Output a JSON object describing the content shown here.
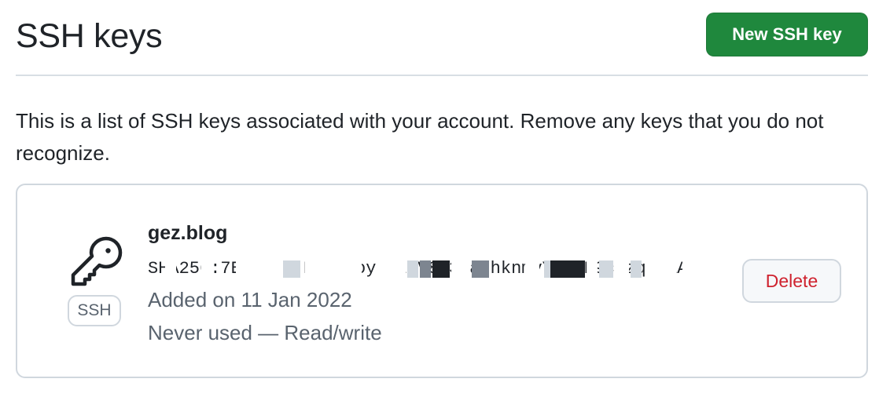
{
  "header": {
    "title": "SSH keys",
    "new_key_button": "New SSH key"
  },
  "description": "This is a list of SSH keys associated with your account. Remove any keys that you do not recognize.",
  "keys": [
    {
      "title": "gez.blog",
      "type_badge": "SSH",
      "fingerprint": "SHA256:7EE+9Cl+DnvfaoyklzFV8y3MazhknmvYxlwF9cNzqeU1A",
      "added": "Added on 11 Jan 2022",
      "usage": "Never used — Read/write",
      "delete_label": "Delete",
      "icon": "key-icon"
    }
  ],
  "colors": {
    "primary_button": "#1f883d",
    "danger_text": "#cf222e",
    "muted_text": "#59636e",
    "border": "#d0d7de"
  }
}
